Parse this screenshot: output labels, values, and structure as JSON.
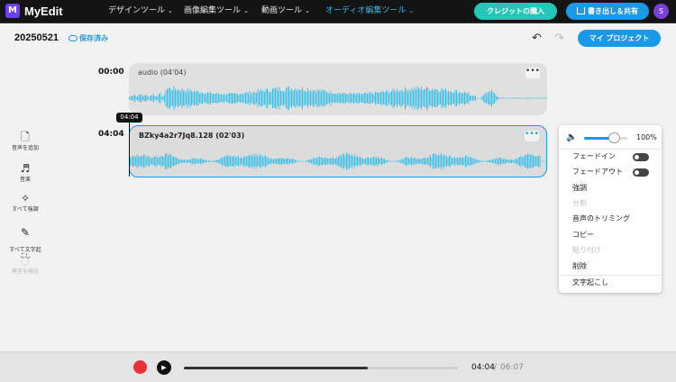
{
  "app": {
    "logo_letter": "M",
    "name": "MyEdit"
  },
  "nav": [
    {
      "label": "デザインツール"
    },
    {
      "label": "画像編集ツール"
    },
    {
      "label": "動画ツール"
    },
    {
      "label": "オーディオ編集ツール"
    }
  ],
  "nav_active_index": 3,
  "top_buttons": {
    "credit": "クレジットの購入",
    "export": "書き出し＆共有"
  },
  "avatar": "S",
  "project": {
    "name": "20250521",
    "saved": "保存済み",
    "my_project": "マイ プロジェクト"
  },
  "tools": [
    {
      "icon": "add-audio-icon",
      "glyph": "🗋",
      "label": "音声を追加"
    },
    {
      "icon": "music-icon",
      "glyph": "♬",
      "label": "音楽"
    },
    {
      "icon": "magic-wand-icon",
      "glyph": "✧",
      "label": "すべて強調"
    },
    {
      "icon": "transcribe-icon",
      "glyph": "✎",
      "label": "すべて文字起\nこし"
    },
    {
      "icon": "silence-detect-icon",
      "glyph": "◌",
      "label": "無音を検出",
      "disabled": true
    }
  ],
  "tracks": [
    {
      "time": "00:00",
      "title": "audio  (04'04)",
      "progress": 0.83
    },
    {
      "time": "04:04",
      "title": "BZky4a2r7Jq8.128  (02'03)",
      "selected": true
    }
  ],
  "playhead": "04:04",
  "context_menu": {
    "volume": "100%",
    "volume_level": 0.75,
    "items": [
      {
        "label": "フェードイン",
        "toggle": true
      },
      {
        "label": "フェードアウト",
        "toggle": true
      },
      {
        "label": "強調"
      },
      {
        "label": "分割",
        "disabled": true
      },
      {
        "label": "音声のトリミング"
      },
      {
        "label": "コピー"
      },
      {
        "label": "貼り付け",
        "disabled": true
      },
      {
        "label": "削除"
      },
      {
        "label": "文字起こし",
        "divider_before": true
      }
    ]
  },
  "player": {
    "current": "04:04",
    "separator": "/",
    "total": "06:07",
    "progress": 0.67
  },
  "colors": {
    "accent": "#1a9ae6",
    "wave": "#3dbfe8",
    "credit": "#25c6b7",
    "record": "#e8303a",
    "brand": "#6b3ff2"
  }
}
